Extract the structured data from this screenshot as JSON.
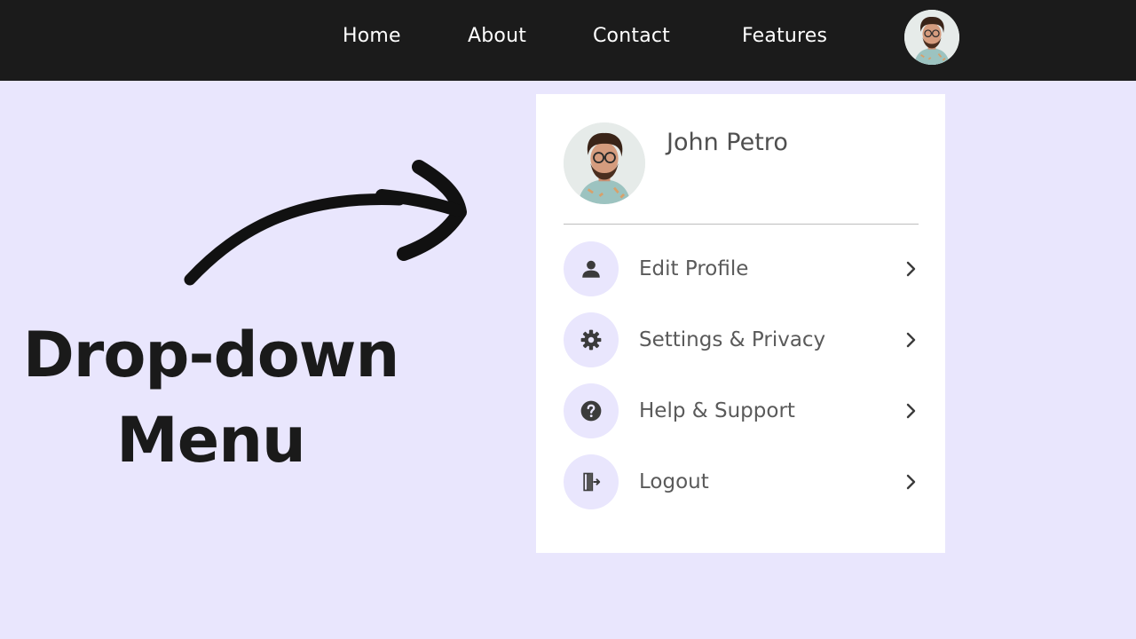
{
  "nav": {
    "links": [
      {
        "label": "Home"
      },
      {
        "label": "About"
      },
      {
        "label": "Contact"
      },
      {
        "label": "Features"
      }
    ]
  },
  "dropdown": {
    "user_name": "John Petro",
    "items": [
      {
        "label": "Edit Profile",
        "icon": "user-icon"
      },
      {
        "label": "Settings & Privacy",
        "icon": "gear-icon"
      },
      {
        "label": "Help & Support",
        "icon": "question-circle-icon"
      },
      {
        "label": "Logout",
        "icon": "logout-door-icon"
      }
    ]
  },
  "headline": {
    "line1": "Drop-down",
    "line2": "Menu"
  },
  "colors": {
    "navbar_bg": "#1b1b1b",
    "page_bg": "#e9e6fd",
    "icon_circle_bg": "#e9e6fd",
    "text_dark": "#1a1a1a"
  }
}
